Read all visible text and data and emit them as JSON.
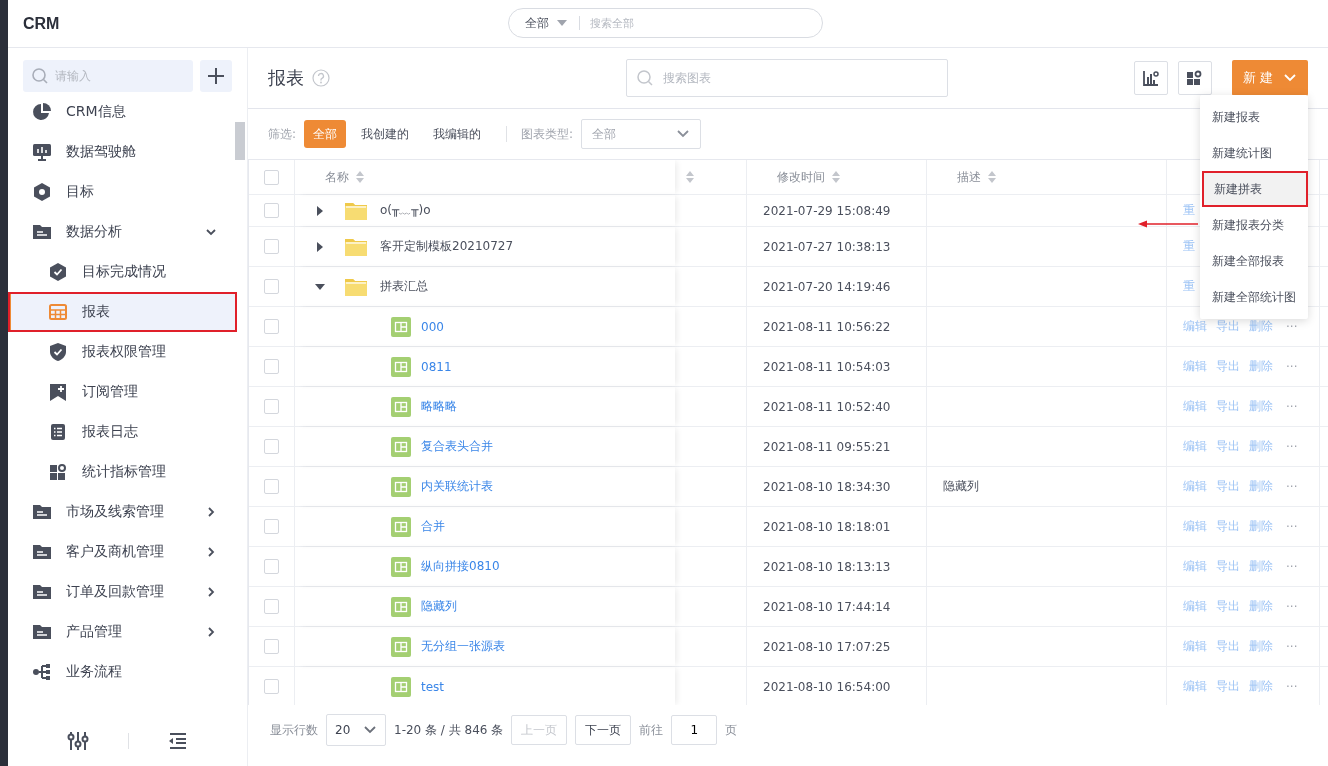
{
  "app": {
    "logo": "CRM",
    "global_search": {
      "scope": "全部",
      "placeholder": "搜索全部"
    }
  },
  "sidebar": {
    "search": {
      "placeholder": "请输入"
    },
    "items": [
      {
        "label": "CRM信息",
        "selected": false
      },
      {
        "label": "数据驾驶舱",
        "selected": false
      },
      {
        "label": "目标",
        "selected": false
      },
      {
        "label": "数据分析",
        "selected": false,
        "expanded": true,
        "children": [
          {
            "label": "目标完成情况",
            "selected": false
          },
          {
            "label": "报表",
            "selected": true,
            "highlighted": true
          },
          {
            "label": "报表权限管理",
            "selected": false
          },
          {
            "label": "订阅管理",
            "selected": false
          },
          {
            "label": "报表日志",
            "selected": false
          },
          {
            "label": "统计指标管理",
            "selected": false
          }
        ]
      },
      {
        "label": "市场及线索管理",
        "selected": false,
        "expanded": false
      },
      {
        "label": "客户及商机管理",
        "selected": false,
        "expanded": false
      },
      {
        "label": "订单及回款管理",
        "selected": false,
        "expanded": false
      },
      {
        "label": "产品管理",
        "selected": false,
        "expanded": false
      },
      {
        "label": "业务流程",
        "selected": false
      }
    ]
  },
  "page": {
    "title": "报表",
    "search": {
      "placeholder": "搜索图表"
    },
    "new_button": {
      "label": "新 建",
      "expanded": true,
      "menu": [
        {
          "label": "新建报表",
          "highlighted": false
        },
        {
          "label": "新建统计图",
          "highlighted": false
        },
        {
          "label": "新建拼表",
          "highlighted": true
        },
        {
          "label": "新建报表分类",
          "highlighted": false
        },
        {
          "label": "新建全部报表",
          "highlighted": false
        },
        {
          "label": "新建全部统计图",
          "highlighted": false
        }
      ]
    }
  },
  "filters": {
    "label": "筛选:",
    "options": [
      {
        "label": "全部",
        "selected": true
      },
      {
        "label": "我创建的",
        "selected": false
      },
      {
        "label": "我编辑的",
        "selected": false
      }
    ],
    "type_label": "图表类型:",
    "type_value": "全部"
  },
  "table": {
    "all_checked": false,
    "columns": [
      "名称",
      "",
      "修改时间",
      "描述"
    ],
    "rows": [
      {
        "kind": "folder",
        "checked": false,
        "expanded": false,
        "name": "o(╥﹏╥)o",
        "modified": "2021-07-29 15:08:49",
        "actions": [
          "重"
        ]
      },
      {
        "kind": "folder",
        "checked": false,
        "expanded": false,
        "name": "客开定制模板20210727",
        "modified": "2021-07-27 10:38:13",
        "actions": [
          "重"
        ]
      },
      {
        "kind": "folder",
        "checked": false,
        "expanded": true,
        "name": "拼表汇总",
        "modified": "2021-07-20 14:19:46",
        "actions": [
          "重"
        ],
        "children": [
          {
            "kind": "report",
            "checked": false,
            "name": "000",
            "modified": "2021-08-11 10:56:22",
            "actions": [
              "编辑",
              "导出",
              "删除"
            ],
            "more": "···"
          },
          {
            "kind": "report",
            "checked": false,
            "name": "0811",
            "modified": "2021-08-11 10:54:03",
            "actions": [
              "编辑",
              "导出",
              "删除"
            ],
            "more": "···"
          },
          {
            "kind": "report",
            "checked": false,
            "name": "略略略",
            "modified": "2021-08-11 10:52:40",
            "actions": [
              "编辑",
              "导出",
              "删除"
            ],
            "more": "···"
          },
          {
            "kind": "report",
            "checked": false,
            "name": "复合表头合并",
            "modified": "2021-08-11 09:55:21",
            "actions": [
              "编辑",
              "导出",
              "删除"
            ],
            "more": "···"
          },
          {
            "kind": "report",
            "checked": false,
            "name": "内关联统计表",
            "modified": "2021-08-10 18:34:30",
            "description": "隐藏列",
            "actions": [
              "编辑",
              "导出",
              "删除"
            ],
            "more": "···"
          },
          {
            "kind": "report",
            "checked": false,
            "name": "合并",
            "modified": "2021-08-10 18:18:01",
            "actions": [
              "编辑",
              "导出",
              "删除"
            ],
            "more": "···"
          },
          {
            "kind": "report",
            "checked": false,
            "name": "纵向拼接0810",
            "modified": "2021-08-10 18:13:13",
            "actions": [
              "编辑",
              "导出",
              "删除"
            ],
            "more": "···"
          },
          {
            "kind": "report",
            "checked": false,
            "name": "隐藏列",
            "modified": "2021-08-10 17:44:14",
            "actions": [
              "编辑",
              "导出",
              "删除"
            ],
            "more": "···"
          },
          {
            "kind": "report",
            "checked": false,
            "name": "无分组一张源表",
            "modified": "2021-08-10 17:07:25",
            "actions": [
              "编辑",
              "导出",
              "删除"
            ],
            "more": "···"
          },
          {
            "kind": "report",
            "checked": false,
            "name": "test",
            "modified": "2021-08-10 16:54:00",
            "actions": [
              "编辑",
              "导出",
              "删除"
            ],
            "more": "···"
          }
        ]
      }
    ]
  },
  "pagination": {
    "rows_label": "显示行数",
    "page_size": "20",
    "range": "1-20 条 / 共 846 条",
    "prev": "上一页",
    "prev_disabled": true,
    "next": "下一页",
    "goto_label": "前往",
    "page": "1",
    "page_suffix": "页"
  }
}
